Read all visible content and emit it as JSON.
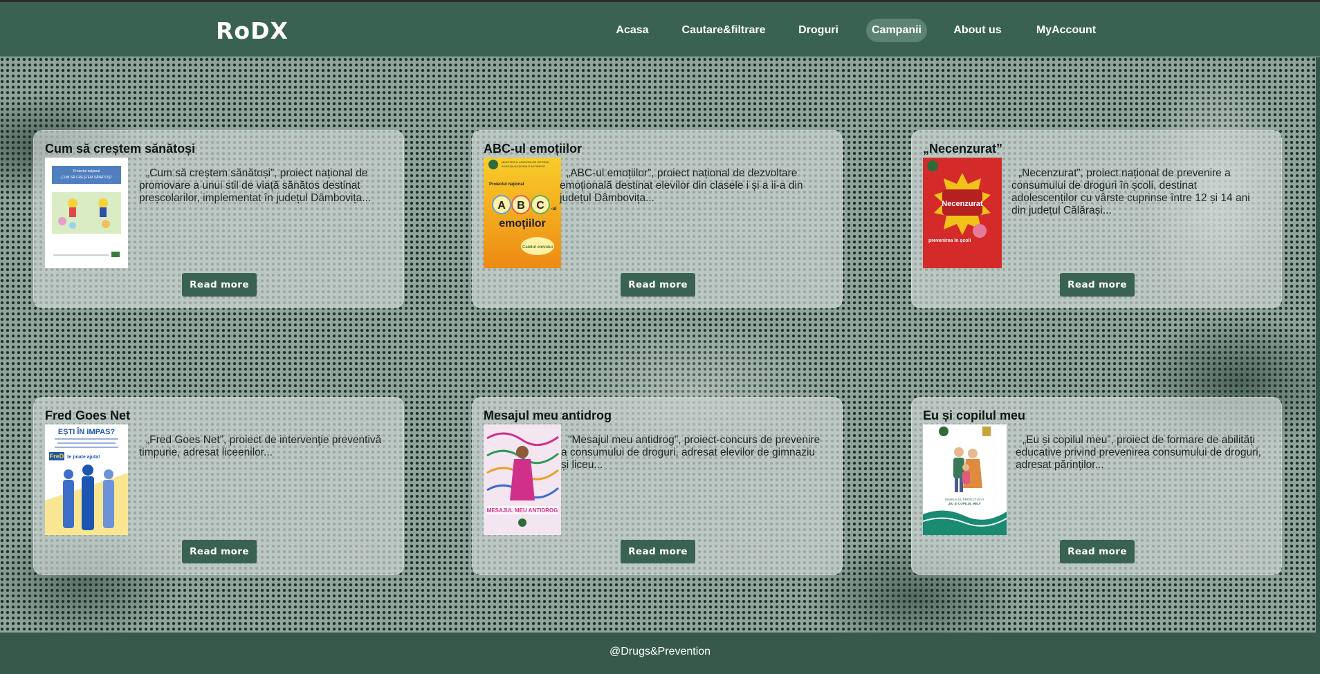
{
  "header": {
    "logo": "RoDX",
    "nav": [
      {
        "label": "Acasa",
        "active": false
      },
      {
        "label": "Cautare&filtrare",
        "active": false
      },
      {
        "label": "Droguri",
        "active": false
      },
      {
        "label": "Campanii",
        "active": true
      },
      {
        "label": "About us",
        "active": false
      },
      {
        "label": "MyAccount",
        "active": false
      }
    ]
  },
  "campaigns": [
    {
      "title": "Cum să creștem sănătoși",
      "description": "„Cum să creștem sănătoși”, proiect național de promovare a unui stil de viață sănătos destinat preșcolarilor, implementat în județul Dâmbovița...",
      "button": "Read more",
      "image": {
        "caption": "Proiectul naţional\n„CUM SĂ CREŞTEM SĂNĂTOŞI”",
        "palette": [
          "#ffffff",
          "#4f7fbf",
          "#c8e0a8"
        ]
      }
    },
    {
      "title": "ABC-ul emoțiilor",
      "description": "„ABC-ul emoțiilor”, proiect național de dezvoltare emoțională destinat elevilor din clasele i și a ii-a din județul Dâmbovița...",
      "button": "Read more",
      "image": {
        "header": "MINISTERUL AFACERILOR INTERNE\nAGENŢIA NAŢIONALĂ ANTIDROG",
        "sub": "Proiectul naţional",
        "letters": "A B C",
        "suffix": "-ul",
        "word": "emoţiilor",
        "badge": "Caietul elevului",
        "palette": [
          "#f6b81c",
          "#e07b12",
          "#fff1a6"
        ]
      }
    },
    {
      "title": "„Necenzurat”",
      "description": "„Necenzurat”, proiect național de prevenire a consumului de droguri în școli, destinat adolescenților cu vârste cuprinse între 12 și 14 ani din județul Călărași...",
      "button": "Read more",
      "image": {
        "word": "Necenzurat",
        "footer": "prevenirea în școli",
        "palette": [
          "#d42a2a",
          "#f2c21b",
          "#b52020"
        ]
      }
    },
    {
      "title": "Fred Goes Net",
      "description": "„Fred Goes Net”, proiect de intervenţie preventivă timpurie, adresat liceenilor...",
      "button": "Read more",
      "image": {
        "heading": "EȘTI ÎN IMPAS?",
        "brand": "FreD",
        "tagline": "te poate ajuta!",
        "palette": [
          "#1d56b0",
          "#f4d23a",
          "#ffffff"
        ]
      }
    },
    {
      "title": "Mesajul meu antidrog",
      "description": "\"Mesajul meu antidrog\", proiect-concurs de prevenire a consumului de droguri, adresat elevilor de gimnaziu și liceu...",
      "button": "Read more",
      "image": {
        "banner": "MESAJUL MEU ANTIDROG",
        "palette": [
          "#f3e6f0",
          "#d0308a",
          "#2f9a5a"
        ]
      }
    },
    {
      "title": "Eu și copilul meu",
      "description": "„Eu și copilul meu”, proiect de formare de abilități educative privind prevenirea consumului de droguri, adresat părinților...",
      "button": "Read more",
      "image": {
        "caption": "MANUALUL PROIECTULUI\n„EU ŞI COPILUL MEU”",
        "palette": [
          "#ffffff",
          "#1a8a72",
          "#f1d9c2"
        ]
      }
    }
  ],
  "footer": {
    "text": "@Drugs&Prevention"
  }
}
